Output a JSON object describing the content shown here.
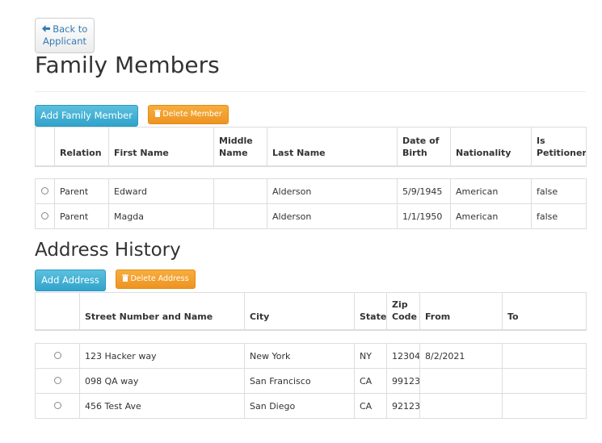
{
  "back_button": {
    "label_line1": "Back to",
    "label_line2": "Applicant",
    "icon": "arrow-left-icon"
  },
  "family": {
    "title": "Family Members",
    "add_label": "Add Family Member",
    "delete_label": "Delete Member",
    "columns": [
      {
        "key": "select",
        "label": ""
      },
      {
        "key": "relation",
        "label": "Relation"
      },
      {
        "key": "first_name",
        "label": "First Name"
      },
      {
        "key": "middle_name",
        "label": "Middle Name"
      },
      {
        "key": "last_name",
        "label": "Last Name"
      },
      {
        "key": "dob",
        "label": "Date of Birth"
      },
      {
        "key": "nationality",
        "label": "Nationality"
      },
      {
        "key": "is_petitioner",
        "label": "Is Petitioner"
      }
    ],
    "rows": [
      {
        "relation": "Parent",
        "first_name": "Edward",
        "middle_name": "",
        "last_name": "Alderson",
        "dob": "5/9/1945",
        "nationality": "American",
        "is_petitioner": "false"
      },
      {
        "relation": "Parent",
        "first_name": "Magda",
        "middle_name": "",
        "last_name": "Alderson",
        "dob": "1/1/1950",
        "nationality": "American",
        "is_petitioner": "false"
      }
    ]
  },
  "address": {
    "title": "Address History",
    "add_label": "Add Address",
    "delete_label": "Delete Address",
    "columns": [
      {
        "key": "select",
        "label": ""
      },
      {
        "key": "street",
        "label": "Street Number and Name"
      },
      {
        "key": "city",
        "label": "City"
      },
      {
        "key": "state",
        "label": "State"
      },
      {
        "key": "zip",
        "label": "Zip Code"
      },
      {
        "key": "from",
        "label": "From"
      },
      {
        "key": "to",
        "label": "To"
      }
    ],
    "rows": [
      {
        "street": "123 Hacker way",
        "city": "New York",
        "state": "NY",
        "zip": "12304",
        "from": "8/2/2021",
        "to": ""
      },
      {
        "street": "098 QA way",
        "city": "San Francisco",
        "state": "CA",
        "zip": "99123",
        "from": "",
        "to": ""
      },
      {
        "street": "456 Test Ave",
        "city": "San Diego",
        "state": "CA",
        "zip": "92123",
        "from": "",
        "to": ""
      }
    ]
  },
  "colors": {
    "primary": "#31a3cb",
    "warning": "#ee9423",
    "link": "#337ab7",
    "border": "#dddddd"
  }
}
